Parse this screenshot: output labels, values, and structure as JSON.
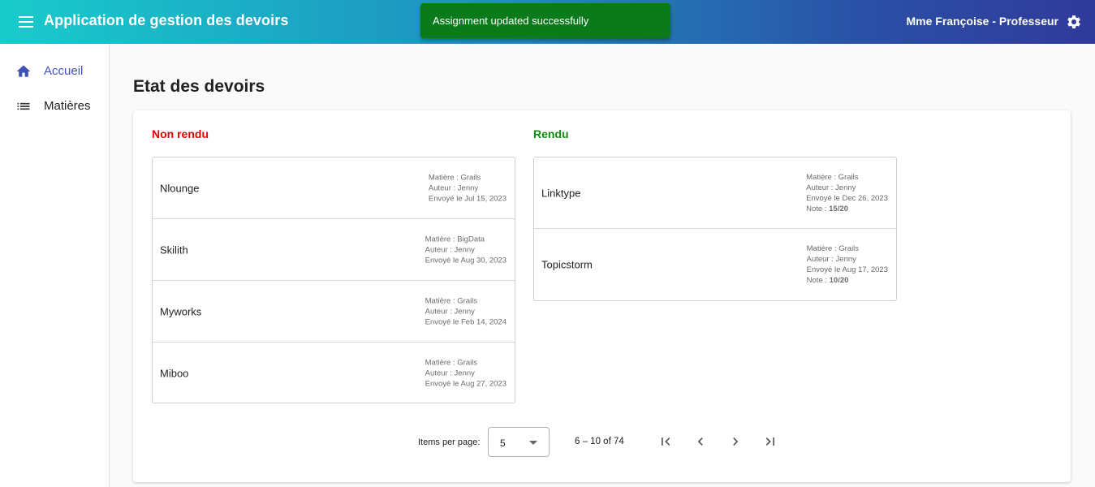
{
  "header": {
    "app_title": "Application de gestion des devoirs",
    "user": "Mme Françoise - Professeur"
  },
  "snackbar": {
    "message": "Assignment updated successfully"
  },
  "sidebar": {
    "items": [
      {
        "label": "Accueil",
        "icon": "home-icon",
        "active": true
      },
      {
        "label": "Matières",
        "icon": "list-icon",
        "active": false
      }
    ]
  },
  "main": {
    "title": "Etat des devoirs",
    "not_submitted": {
      "heading": "Non rendu",
      "items": [
        {
          "name": "Nlounge",
          "subject": "Matière : Grails",
          "author": "Auteur : Jenny",
          "sent": "Envoyé le Jul 15, 2023"
        },
        {
          "name": "Skilith",
          "subject": "Matière : BigData",
          "author": "Auteur : Jenny",
          "sent": "Envoyé le Aug 30, 2023"
        },
        {
          "name": "Myworks",
          "subject": "Matière : Grails",
          "author": "Auteur : Jenny",
          "sent": "Envoyé le Feb 14, 2024"
        },
        {
          "name": "Miboo",
          "subject": "Matière : Grails",
          "author": "Auteur : Jenny",
          "sent": "Envoyé le Aug 27, 2023"
        }
      ]
    },
    "submitted": {
      "heading": "Rendu",
      "items": [
        {
          "name": "Linktype",
          "subject": "Matière : Grails",
          "author": "Auteur : Jenny",
          "sent": "Envoyé le Dec 26, 2023",
          "note_label": "Note : ",
          "note_value": "15/20"
        },
        {
          "name": "Topicstorm",
          "subject": "Matière : Grails",
          "author": "Auteur : Jenny",
          "sent": "Envoyé le Aug 17, 2023",
          "note_label": "Note : ",
          "note_value": "10/20"
        }
      ]
    }
  },
  "paginator": {
    "items_per_page_label": "Items per page:",
    "page_size": "5",
    "range": "6 – 10 of 74"
  },
  "colors": {
    "header_gradient_start": "#19cbcb",
    "header_gradient_end": "#303a9a",
    "snackbar": "#0b7a1b",
    "not_submitted": "#e60000",
    "submitted": "#138a13",
    "active_nav": "#3f51b5"
  }
}
